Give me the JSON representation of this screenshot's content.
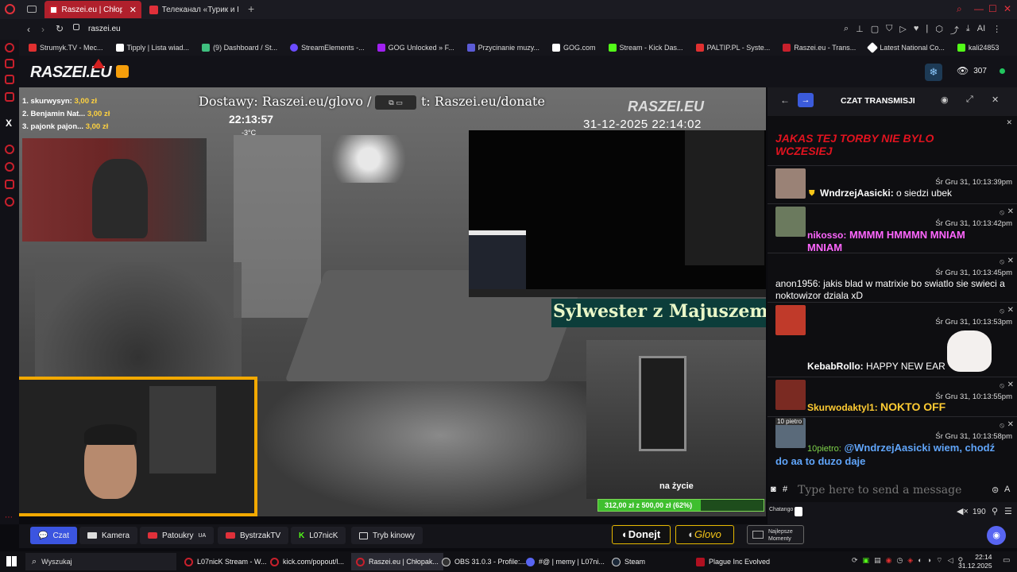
{
  "tabs": [
    {
      "label": "Raszei.eu | Chłopak",
      "active": true,
      "color": "#c8202c"
    },
    {
      "label": "Телеканал «Турик и Конс",
      "active": false,
      "color": "#e0303a"
    }
  ],
  "address": "raszei.eu",
  "bookmarks": [
    {
      "label": "Strumyk.TV - Mec...",
      "color": "#e03030"
    },
    {
      "label": "Tipply | Lista wiad...",
      "color": "#ffffff"
    },
    {
      "label": "(9) Dashboard / St...",
      "color": "#3fbf7f"
    },
    {
      "label": "StreamElements -...",
      "color": "#6b4cff"
    },
    {
      "label": "GOG Unlocked » F...",
      "color": "#a020f0"
    },
    {
      "label": "Przycinanie muzy...",
      "color": "#5b5bd6"
    },
    {
      "label": "GOG.com",
      "color": "#ffffff"
    },
    {
      "label": "Stream - Kick Das...",
      "color": "#53fc18"
    },
    {
      "label": "PALTIP.PL - Syste...",
      "color": "#e03030"
    },
    {
      "label": "Raszei.eu - Trans...",
      "color": "#c8202c"
    },
    {
      "label": "Latest National Co...",
      "color": "#ffffff"
    },
    {
      "label": "kali24853",
      "color": "#53fc18"
    }
  ],
  "site": {
    "logo": "RASZEI.EU",
    "viewers": "307",
    "live_color": "#22c55e"
  },
  "stream": {
    "leaderboard": [
      {
        "name": "1. skurwysyn:",
        "amount": "3,00 zł"
      },
      {
        "name": "2. Benjamin Nat...",
        "amount": "3,00 zł"
      },
      {
        "name": "3. pajonk pajon...",
        "amount": "3,00 zł"
      }
    ],
    "banner_left": "Dostawy: Raszei.eu/glovo /",
    "banner_right": "t: Raszei.eu/donate",
    "clock": "22:13:57",
    "temp": "-3°C",
    "watermark": "RASZEI.EU",
    "cam_timestamp": "31-12-2025 22:14:02",
    "title_overlay": "Sylwester z Majuszem",
    "goal_label": "na życie",
    "goal_progress": "312,00 zł z 500,00 zł (62%)",
    "goal_fraction": 0.62
  },
  "chat": {
    "title": "CZAT TRANSMISJI",
    "pinned": "JAKAS TEJ TORBY NIE BYLO WCZESIEJ",
    "messages": [
      {
        "time": "Śr Gru 31, 10:13:39pm",
        "user": "WndrzejAasicki:",
        "text": "o siedzi ubek",
        "user_color": "#ffffff",
        "text_color": "#ffffff"
      },
      {
        "time": "Śr Gru 31, 10:13:42pm",
        "user": "nikosso:",
        "text": "MMMM HMMMN MNIAM MNIAM",
        "user_color": "#ff66ff",
        "text_color": "#ff66ff"
      },
      {
        "time": "Śr Gru 31, 10:13:45pm",
        "user": "anon1956:",
        "text": "jakis blad w matrixie bo swiatlo sie swieci a noktowizor dziala xD",
        "user_color": "#ffffff",
        "text_color": "#ffffff"
      },
      {
        "time": "Śr Gru 31, 10:13:53pm",
        "user": "KebabRollo:",
        "text": "HAPPY NEW EAR",
        "user_color": "#ffffff",
        "text_color": "#ffffff"
      },
      {
        "time": "Śr Gru 31, 10:13:55pm",
        "user": "Skurwodaktyl1:",
        "text": "NOKTO OFF",
        "user_color": "#ffcc33",
        "text_color": "#ffcc33"
      },
      {
        "time": "Śr Gru 31, 10:13:58pm",
        "user": "10pietro:",
        "text": "@WndrzejAasicki wiem, chodź do aa to duzo daje",
        "user_color": "#7fd34a",
        "text_color": "#60a5fa"
      }
    ],
    "avatar_label": "10 pietro",
    "input_placeholder": "Type here to send a message",
    "hash": "#",
    "chatango": "Chatango",
    "volume": "190"
  },
  "bottom_nav": [
    {
      "label": "Czat",
      "icon": "chat-icon",
      "active": true
    },
    {
      "label": "Kamera",
      "icon": "camera-icon",
      "active": false
    },
    {
      "label": "Patoukry",
      "suffix": "UA",
      "icon": "youtube-icon",
      "active": false
    },
    {
      "label": "BystrzakTV",
      "icon": "youtube-icon",
      "active": false
    },
    {
      "label": "L07nicK",
      "icon": "kick-icon",
      "active": false
    },
    {
      "label": "Tryb kinowy",
      "icon": "theater-icon",
      "active": false
    }
  ],
  "cta": {
    "donejt": "Donejt",
    "glovo": "Glovo",
    "best": "Najlepsze Momenty"
  },
  "taskbar": {
    "search": "Wyszukaj",
    "items": [
      {
        "label": "L07nicK Stream - W...",
        "color": "#c8202c"
      },
      {
        "label": "kick.com/popout/l...",
        "color": "#c8202c"
      },
      {
        "label": "Raszei.eu | Chłopak...",
        "color": "#c8202c"
      },
      {
        "label": "OBS 31.0.3 - Profile:...",
        "color": "#333333"
      },
      {
        "label": "#@ | memy | L07ni...",
        "color": "#5865f2"
      },
      {
        "label": "Steam",
        "color": "#1b2838"
      },
      {
        "label": "Plague Inc Evolved",
        "color": "#b01020"
      }
    ],
    "time": "22:14",
    "date": "31.12.2025"
  }
}
